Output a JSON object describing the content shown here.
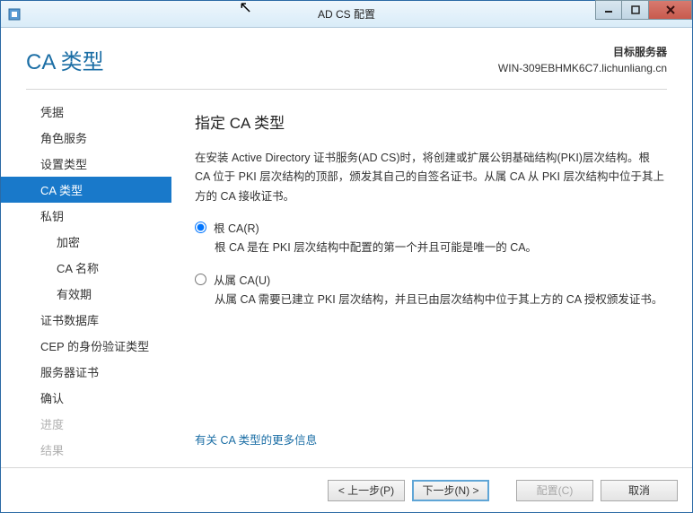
{
  "window": {
    "title": "AD CS 配置"
  },
  "header": {
    "page_title": "CA 类型",
    "target_label": "目标服务器",
    "target_value": "WIN-309EBHMK6C7.lichunliang.cn"
  },
  "sidebar": {
    "items": [
      {
        "label": "凭据",
        "indent": 0,
        "selected": false,
        "disabled": false
      },
      {
        "label": "角色服务",
        "indent": 0,
        "selected": false,
        "disabled": false
      },
      {
        "label": "设置类型",
        "indent": 0,
        "selected": false,
        "disabled": false
      },
      {
        "label": "CA 类型",
        "indent": 0,
        "selected": true,
        "disabled": false
      },
      {
        "label": "私钥",
        "indent": 0,
        "selected": false,
        "disabled": false
      },
      {
        "label": "加密",
        "indent": 1,
        "selected": false,
        "disabled": false
      },
      {
        "label": "CA 名称",
        "indent": 1,
        "selected": false,
        "disabled": false
      },
      {
        "label": "有效期",
        "indent": 1,
        "selected": false,
        "disabled": false
      },
      {
        "label": "证书数据库",
        "indent": 0,
        "selected": false,
        "disabled": false
      },
      {
        "label": "CEP 的身份验证类型",
        "indent": 0,
        "selected": false,
        "disabled": false
      },
      {
        "label": "服务器证书",
        "indent": 0,
        "selected": false,
        "disabled": false
      },
      {
        "label": "确认",
        "indent": 0,
        "selected": false,
        "disabled": false
      },
      {
        "label": "进度",
        "indent": 0,
        "selected": false,
        "disabled": true
      },
      {
        "label": "结果",
        "indent": 0,
        "selected": false,
        "disabled": true
      }
    ]
  },
  "main": {
    "heading": "指定 CA 类型",
    "description": "在安装 Active Directory 证书服务(AD CS)时，将创建或扩展公钥基础结构(PKI)层次结构。根 CA 位于 PKI 层次结构的顶部，颁发其自己的自签名证书。从属 CA 从 PKI 层次结构中位于其上方的 CA 接收证书。",
    "option_root": {
      "label": "根 CA(R)",
      "desc": "根 CA 是在 PKI 层次结构中配置的第一个并且可能是唯一的 CA。",
      "checked": true
    },
    "option_sub": {
      "label": "从属 CA(U)",
      "desc": "从属 CA 需要已建立 PKI 层次结构，并且已由层次结构中位于其上方的 CA 授权颁发证书。",
      "checked": false
    },
    "more_link": "有关 CA 类型的更多信息"
  },
  "footer": {
    "prev": "< 上一步(P)",
    "next": "下一步(N) >",
    "configure": "配置(C)",
    "cancel": "取消"
  }
}
